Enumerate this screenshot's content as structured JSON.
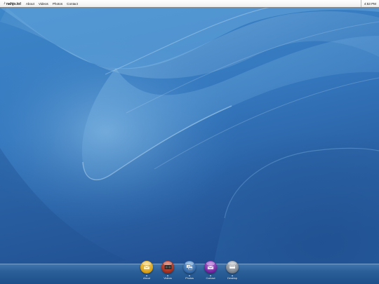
{
  "menubar": {
    "logo": "♪",
    "brand": "nahjo.tol",
    "items": [
      {
        "label": "About"
      },
      {
        "label": "Videos"
      },
      {
        "label": "Photos"
      },
      {
        "label": "Contact"
      }
    ],
    "clock": "4:53 PM"
  },
  "dock": {
    "items": [
      {
        "label": "About",
        "icon": "mail-folder-icon",
        "color": "#e6b31b"
      },
      {
        "label": "Videos",
        "icon": "film-icon",
        "color": "#a33a2a"
      },
      {
        "label": "Photos",
        "icon": "photos-icon",
        "color": "#3b6fa8"
      },
      {
        "label": "Contact",
        "icon": "envelope-icon",
        "color": "#7a2ba6"
      },
      {
        "label": "Desktop",
        "icon": "desktop-icon",
        "color": "#7f8790"
      }
    ]
  },
  "colors": {
    "wallpaper_base": "#2f73b7",
    "wallpaper_light": "#9ccaec",
    "dock_floor": "#2a5f98"
  }
}
